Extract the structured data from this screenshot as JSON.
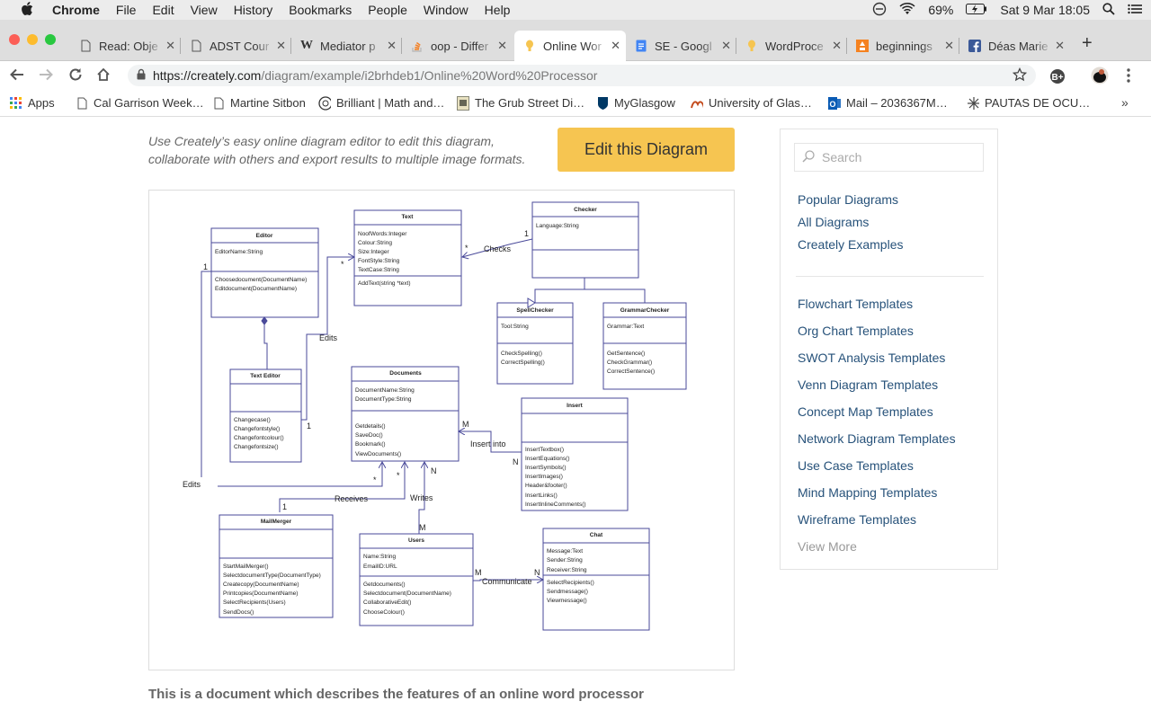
{
  "menubar": {
    "app": "Chrome",
    "items": [
      "File",
      "Edit",
      "View",
      "History",
      "Bookmarks",
      "People",
      "Window",
      "Help"
    ],
    "battery": "69%",
    "datetime": "Sat 9 Mar  18:05"
  },
  "tabs": [
    {
      "title": "Read: Obje",
      "icon": "doc-icon"
    },
    {
      "title": "ADST Cour",
      "icon": "doc-icon"
    },
    {
      "title": "Mediator p",
      "icon": "wikipedia-icon"
    },
    {
      "title": "oop - Differ",
      "icon": "stackoverflow-icon"
    },
    {
      "title": "Online Wor",
      "icon": "creately-icon",
      "active": true
    },
    {
      "title": "SE - Googl",
      "icon": "google-docs-icon"
    },
    {
      "title": "WordProce",
      "icon": "creately-icon"
    },
    {
      "title": "beginnings",
      "icon": "orange-grid-icon"
    },
    {
      "title": "Déas Marie",
      "icon": "facebook-icon"
    }
  ],
  "toolbar": {
    "url_host": "https://creately.com",
    "url_path": "/diagram/example/i2brhdeb1/Online%20Word%20Processor"
  },
  "bookmarks": [
    {
      "label": "Apps",
      "icon": "apps-grid-icon"
    },
    {
      "label": "Cal Garrison Week…",
      "icon": "page-icon"
    },
    {
      "label": "Martine Sitbon",
      "icon": "page-icon"
    },
    {
      "label": "Brilliant | Math and…",
      "icon": "brilliant-icon"
    },
    {
      "label": "The Grub Street Di…",
      "icon": "grub-street-icon"
    },
    {
      "label": "MyGlasgow",
      "icon": "glasgow-crest-icon"
    },
    {
      "label": "University of Glas…",
      "icon": "uog-icon"
    },
    {
      "label": "Mail – 2036367M…",
      "icon": "outlook-icon"
    },
    {
      "label": "PAUTAS DE OCU…",
      "icon": "sun-icon"
    }
  ],
  "page": {
    "intro": "Use Creately’s easy online diagram editor to edit this diagram, collaborate with others and export results to multiple image formats.",
    "edit_button": "Edit this Diagram",
    "caption": "This is a document which describes the features of an online word processor"
  },
  "sidebar": {
    "search_placeholder": "Search",
    "links_top": [
      "Popular Diagrams",
      "All Diagrams",
      "Creately Examples"
    ],
    "links_templates": [
      "Flowchart Templates",
      "Org Chart Templates",
      "SWOT Analysis Templates",
      "Venn Diagram Templates",
      "Concept Map Templates",
      "Network Diagram Templates",
      "Use Case Templates",
      "Mind Mapping Templates",
      "Wireframe Templates"
    ],
    "view_more": "View More"
  },
  "diagram": {
    "classes": {
      "editor": {
        "name": "Editor",
        "attrs": [
          "EditorName:String"
        ],
        "ops": [
          "Choosedocument(DocumentName)",
          "Editdocument(DocumentName)"
        ]
      },
      "text": {
        "name": "Text",
        "attrs": [
          "NoofWords:Integer",
          "Colour:String",
          "Size:Integer",
          "FontStyle:String",
          "TextCase:String"
        ],
        "ops": [
          "AddText(string *text)"
        ]
      },
      "checker": {
        "name": "Checker",
        "attrs": [
          "Language:String"
        ],
        "ops": []
      },
      "spellchecker": {
        "name": "SpellChecker",
        "attrs": [
          "Tool:String"
        ],
        "ops": [
          "CheckSpelling()",
          "CorrectSpelling()"
        ]
      },
      "grammarchecker": {
        "name": "GrammarChecker",
        "attrs": [
          "Grammar:Text"
        ],
        "ops": [
          "GetSentence()",
          "CheckGrammar()",
          "CorrectSentence()"
        ]
      },
      "texteditor": {
        "name": "Text Editor",
        "attrs": [],
        "ops": [
          "Changecase()",
          "Changefontstyle()",
          "Changefontcolour()",
          "Changefontsize()"
        ]
      },
      "documents": {
        "name": "Documents",
        "attrs": [
          "DocumentName:String",
          "DocumentType:String"
        ],
        "ops": [
          "Getdetails()",
          "SaveDoc()",
          "Bookmark()",
          "ViewDocuments()"
        ]
      },
      "insert": {
        "name": "Insert",
        "attrs": [],
        "ops": [
          "InsertTextbox()",
          "InsertEquations()",
          "InsertSymbols()",
          "InsertImages()",
          "Header&footer()",
          "InsertLinks()",
          "InsertInlineComments()"
        ]
      },
      "mailmerger": {
        "name": "MailMerger",
        "attrs": [],
        "ops": [
          "StartMailMerger()",
          "SelectdocumentType(DocumentType)",
          "Createcopy(DocumentName)",
          "Printcopies(DocumentName)",
          "SelectRecipients(Users)",
          "SendDocs()"
        ]
      },
      "users": {
        "name": "Users",
        "attrs": [
          "Name:String",
          "EmailID:URL"
        ],
        "ops": [
          "Getdocuments()",
          "Selectdocument(DocumentName)",
          "CollaborativeEdit()",
          "ChooseColour()"
        ]
      },
      "chat": {
        "name": "Chat",
        "attrs": [
          "Message:Text",
          "Sender:String",
          "Receiver:String"
        ],
        "ops": [
          "SelectRecipients()",
          "Sendmessage()",
          "Viewmessage()"
        ]
      }
    },
    "labels": {
      "checks": "Checks",
      "edits1": "Edits",
      "edits2": "Edits",
      "receives": "Receives",
      "writes": "Writes",
      "insert_into": "Insert  into",
      "communicate": "Communicate",
      "one": "1",
      "star": "*",
      "m": "M",
      "n": "N"
    }
  }
}
